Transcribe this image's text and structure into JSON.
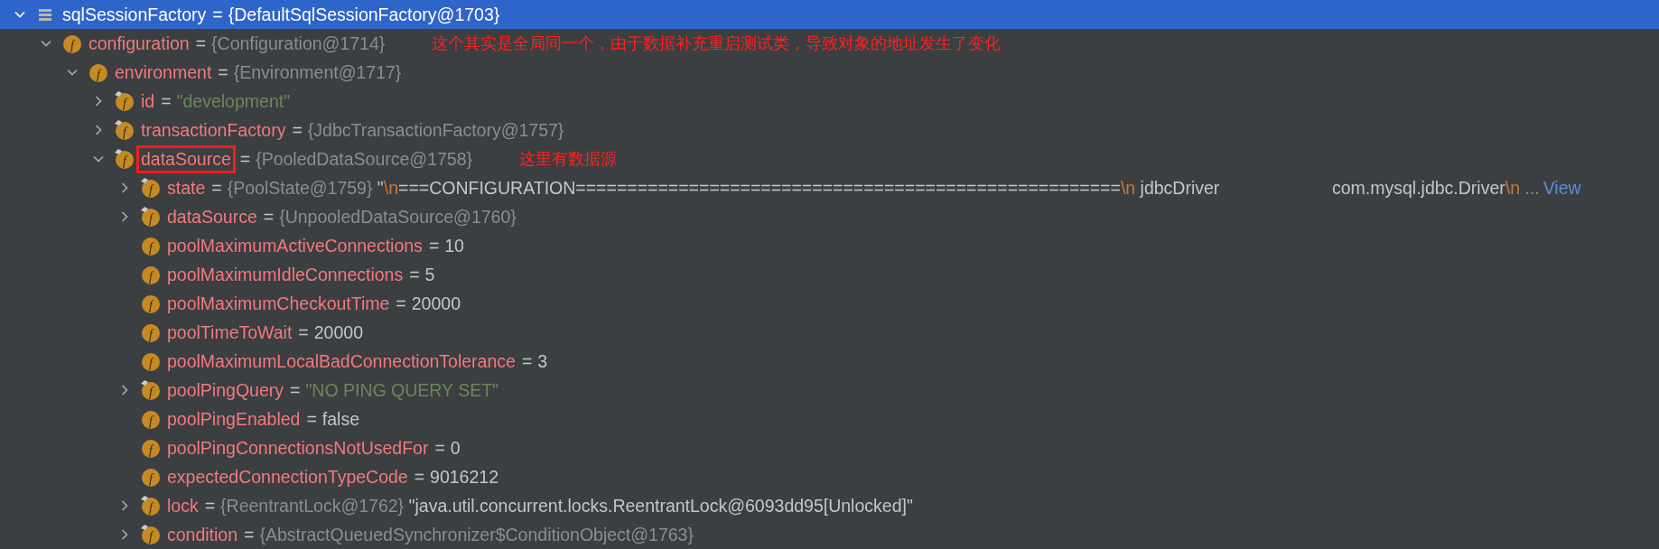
{
  "tree": [
    {
      "kind": "root",
      "name": "sqlSessionFactory",
      "separator": "=",
      "selected": true,
      "expanded": true,
      "value": [
        {
          "kind": "ref",
          "text": "{DefaultSqlSessionFactory@1703}"
        }
      ],
      "children": [
        {
          "kind": "field",
          "icon_letter": "f",
          "marked": false,
          "name": "configuration",
          "separator": "=",
          "selected": false,
          "expanded": true,
          "value": [
            {
              "kind": "ref",
              "text": "{Configuration@1714}"
            }
          ],
          "annotation": "这个其实是全局同一个，由于数据补充重启测试类，导致对象的地址发生了变化",
          "children": [
            {
              "kind": "field",
              "icon_letter": "f",
              "marked": false,
              "name": "environment",
              "separator": "=",
              "selected": false,
              "expanded": true,
              "value": [
                {
                  "kind": "ref",
                  "text": "{Environment@1717}"
                }
              ],
              "children": [
                {
                  "kind": "field",
                  "icon_letter": "f",
                  "marked": true,
                  "name": "id",
                  "separator": "=",
                  "selected": false,
                  "expanded": false,
                  "value": [
                    {
                      "kind": "string",
                      "text": "\"development\""
                    }
                  ]
                },
                {
                  "kind": "field",
                  "icon_letter": "f",
                  "marked": true,
                  "name": "transactionFactory",
                  "separator": "=",
                  "selected": false,
                  "expanded": false,
                  "value": [
                    {
                      "kind": "ref",
                      "text": "{JdbcTransactionFactory@1757}"
                    }
                  ]
                },
                {
                  "kind": "field",
                  "icon_letter": "f",
                  "marked": true,
                  "name": "dataSource",
                  "boxed": true,
                  "separator": "=",
                  "selected": false,
                  "expanded": true,
                  "value": [
                    {
                      "kind": "ref",
                      "text": "{PooledDataSource@1758}"
                    }
                  ],
                  "annotation": "这里有数据源",
                  "children": [
                    {
                      "kind": "field",
                      "icon_letter": "f",
                      "marked": true,
                      "name": "state",
                      "separator": "=",
                      "selected": false,
                      "expanded": false,
                      "value": [
                        {
                          "kind": "ref",
                          "text": "{PoolState@1759}"
                        },
                        {
                          "kind": "plain",
                          "text": " \""
                        },
                        {
                          "kind": "escape",
                          "text": "\\n"
                        },
                        {
                          "kind": "plain",
                          "text": "===CONFIGURATION====================================================="
                        },
                        {
                          "kind": "escape",
                          "text": "\\n"
                        },
                        {
                          "kind": "plain",
                          "text": " jdbcDriver                       com.mysql.jdbc.Driver"
                        },
                        {
                          "kind": "escape",
                          "text": "\\n"
                        },
                        {
                          "kind": "ref",
                          "text": " ..."
                        },
                        {
                          "kind": "link",
                          "text": "View"
                        }
                      ]
                    },
                    {
                      "kind": "field",
                      "icon_letter": "f",
                      "marked": true,
                      "name": "dataSource",
                      "separator": "=",
                      "selected": false,
                      "expanded": false,
                      "value": [
                        {
                          "kind": "ref",
                          "text": "{UnpooledDataSource@1760}"
                        }
                      ]
                    },
                    {
                      "kind": "field",
                      "icon_letter": "f",
                      "marked": false,
                      "name": "poolMaximumActiveConnections",
                      "separator": "=",
                      "selected": false,
                      "value": [
                        {
                          "kind": "plain",
                          "text": "10"
                        }
                      ]
                    },
                    {
                      "kind": "field",
                      "icon_letter": "f",
                      "marked": false,
                      "name": "poolMaximumIdleConnections",
                      "separator": "=",
                      "selected": false,
                      "value": [
                        {
                          "kind": "plain",
                          "text": "5"
                        }
                      ]
                    },
                    {
                      "kind": "field",
                      "icon_letter": "f",
                      "marked": false,
                      "name": "poolMaximumCheckoutTime",
                      "separator": "=",
                      "selected": false,
                      "value": [
                        {
                          "kind": "plain",
                          "text": "20000"
                        }
                      ]
                    },
                    {
                      "kind": "field",
                      "icon_letter": "f",
                      "marked": false,
                      "name": "poolTimeToWait",
                      "separator": "=",
                      "selected": false,
                      "value": [
                        {
                          "kind": "plain",
                          "text": "20000"
                        }
                      ]
                    },
                    {
                      "kind": "field",
                      "icon_letter": "f",
                      "marked": false,
                      "name": "poolMaximumLocalBadConnectionTolerance",
                      "separator": "=",
                      "selected": false,
                      "value": [
                        {
                          "kind": "plain",
                          "text": "3"
                        }
                      ]
                    },
                    {
                      "kind": "field",
                      "icon_letter": "f",
                      "marked": true,
                      "name": "poolPingQuery",
                      "separator": "=",
                      "selected": false,
                      "expanded": false,
                      "value": [
                        {
                          "kind": "string",
                          "text": "\"NO PING QUERY SET\""
                        }
                      ]
                    },
                    {
                      "kind": "field",
                      "icon_letter": "f",
                      "marked": false,
                      "name": "poolPingEnabled",
                      "separator": "=",
                      "selected": false,
                      "value": [
                        {
                          "kind": "plain",
                          "text": "false"
                        }
                      ]
                    },
                    {
                      "kind": "field",
                      "icon_letter": "f",
                      "marked": false,
                      "name": "poolPingConnectionsNotUsedFor",
                      "separator": "=",
                      "selected": false,
                      "value": [
                        {
                          "kind": "plain",
                          "text": "0"
                        }
                      ]
                    },
                    {
                      "kind": "field",
                      "icon_letter": "f",
                      "marked": false,
                      "name": "expectedConnectionTypeCode",
                      "separator": "=",
                      "selected": false,
                      "value": [
                        {
                          "kind": "plain",
                          "text": "9016212"
                        }
                      ]
                    },
                    {
                      "kind": "field",
                      "icon_letter": "f",
                      "marked": true,
                      "name": "lock",
                      "separator": "=",
                      "selected": false,
                      "expanded": false,
                      "value": [
                        {
                          "kind": "ref",
                          "text": "{ReentrantLock@1762}"
                        },
                        {
                          "kind": "plain",
                          "text": " \"java.util.concurrent.locks.ReentrantLock@6093dd95[Unlocked]\""
                        }
                      ]
                    },
                    {
                      "kind": "field",
                      "icon_letter": "f",
                      "marked": true,
                      "name": "condition",
                      "separator": "=",
                      "selected": false,
                      "expanded": false,
                      "value": [
                        {
                          "kind": "ref",
                          "text": "{AbstractQueuedSynchronizer$ConditionObject@1763}"
                        }
                      ]
                    }
                  ]
                }
              ]
            }
          ]
        }
      ]
    }
  ]
}
